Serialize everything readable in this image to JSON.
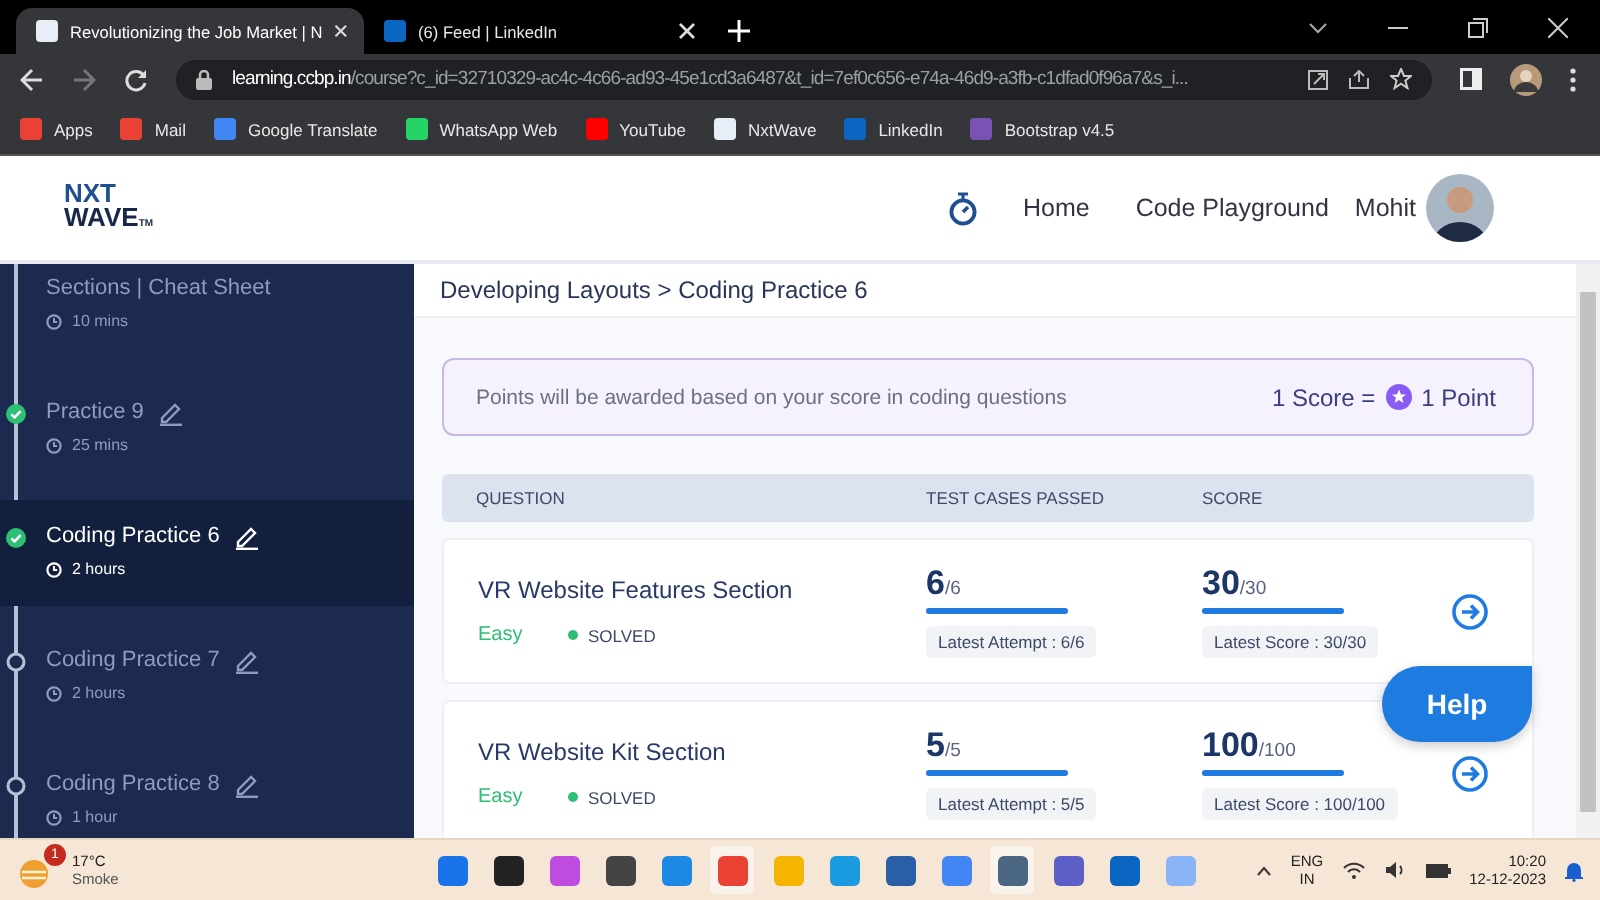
{
  "browser": {
    "tabs": [
      {
        "title": "Revolutionizing the Job Market | N",
        "selected": true
      },
      {
        "title": "(6) Feed | LinkedIn",
        "selected": false
      }
    ],
    "url": {
      "host": "learning.ccbp.in",
      "path": "/course?c_id=32710329-ac4c-4c66-ad93-45e1cd3a6487&t_id=7ef0c656-e74a-46d9-a3fb-c1dfad0f96a7&s_i..."
    },
    "bookmarks": [
      "Apps",
      "Mail",
      "Google Translate",
      "WhatsApp Web",
      "YouTube",
      "NxtWave",
      "LinkedIn",
      "Bootstrap v4.5"
    ]
  },
  "header": {
    "logo_top": "NXT",
    "logo_bottom": "WAVE",
    "logo_mark": "TM",
    "nav": [
      "Home",
      "Code Playground"
    ],
    "user": "Mohit"
  },
  "sidebar": {
    "items": [
      {
        "kind": "section",
        "title": "Sections | Cheat Sheet",
        "duration": "10 mins",
        "selected": false
      },
      {
        "kind": "practice",
        "title": "Practice 9",
        "duration": "25 mins",
        "completed": true,
        "selected": false
      },
      {
        "kind": "practice",
        "title": "Coding Practice 6",
        "duration": "2 hours",
        "completed": true,
        "selected": true
      },
      {
        "kind": "practice",
        "title": "Coding Practice 7",
        "duration": "2 hours",
        "completed": false,
        "selected": false
      },
      {
        "kind": "practice",
        "title": "Coding Practice 8",
        "duration": "1 hour",
        "completed": false,
        "selected": false
      }
    ]
  },
  "breadcrumb": "Developing Layouts > Coding Practice 6",
  "notice": {
    "text": "Points will be awarded based on your score in coding questions",
    "score": "1 Score =",
    "point": "1 Point"
  },
  "table": {
    "columns": [
      "QUESTION",
      "TEST CASES PASSED",
      "SCORE"
    ],
    "rows": [
      {
        "title": "VR Website Features Section",
        "difficulty": "Easy",
        "status": "SOLVED",
        "tests": {
          "value": "6",
          "total": "/6",
          "level": 1,
          "note": "Latest Attempt : 6/6"
        },
        "score": {
          "value": "30",
          "total": "/30",
          "level": 1,
          "note": "Latest Score : 30/30"
        }
      },
      {
        "title": "VR Website Kit Section",
        "difficulty": "Easy",
        "status": "SOLVED",
        "tests": {
          "value": "5",
          "total": "/5",
          "level": 1,
          "note": "Latest Attempt : 5/5"
        },
        "score": {
          "value": "100",
          "total": "/100",
          "level": 1,
          "note": "Latest Score : 100/100"
        }
      }
    ]
  },
  "help": "Help",
  "taskbar": {
    "temperature": "17°C",
    "weather": "Smoke",
    "badge": "1",
    "lang": "ENG",
    "region": "IN",
    "time": "10:20",
    "date": "12-12-2023"
  }
}
